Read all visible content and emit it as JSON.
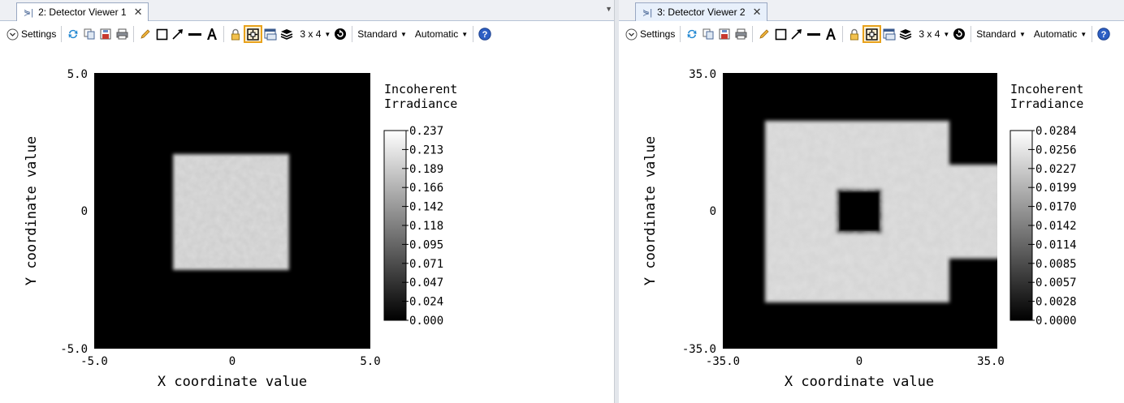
{
  "viewers": [
    {
      "tab_label": "2: Detector Viewer 1",
      "toolbar": {
        "settings_label": "Settings",
        "grid_label": "3 x 4",
        "style_label": "Standard",
        "scale_label": "Automatic"
      },
      "plot": {
        "y_max_label": "5.0",
        "y_mid_label": "0",
        "y_min_label": "-5.0",
        "x_min_label": "-5.0",
        "x_mid_label": "0",
        "x_max_label": "5.0",
        "xlabel": "X coordinate value",
        "ylabel": "Y coordinate value",
        "legend_title_line1": "Incoherent",
        "legend_title_line2": "Irradiance",
        "colorbar_ticks": [
          "0.237",
          "0.213",
          "0.189",
          "0.166",
          "0.142",
          "0.118",
          "0.095",
          "0.071",
          "0.047",
          "0.024",
          "0.000"
        ]
      }
    },
    {
      "tab_label": "3: Detector Viewer 2",
      "toolbar": {
        "settings_label": "Settings",
        "grid_label": "3 x 4",
        "style_label": "Standard",
        "scale_label": "Automatic"
      },
      "plot": {
        "y_max_label": "35.0",
        "y_mid_label": "0",
        "y_min_label": "-35.0",
        "x_min_label": "-35.0",
        "x_mid_label": "0",
        "x_max_label": "35.0",
        "xlabel": "X coordinate value",
        "ylabel": "Y coordinate value",
        "legend_title_line1": "Incoherent",
        "legend_title_line2": "Irradiance",
        "colorbar_ticks": [
          "0.0284",
          "0.0256",
          "0.0227",
          "0.0199",
          "0.0170",
          "0.0142",
          "0.0114",
          "0.0085",
          "0.0057",
          "0.0028",
          "0.0000"
        ]
      }
    }
  ],
  "colors": {
    "tab_accent": "#99a8c2",
    "selected_tool": "#e8a21c",
    "help_icon": "#2d5fc4",
    "refresh_icon": "#1f86d1"
  }
}
